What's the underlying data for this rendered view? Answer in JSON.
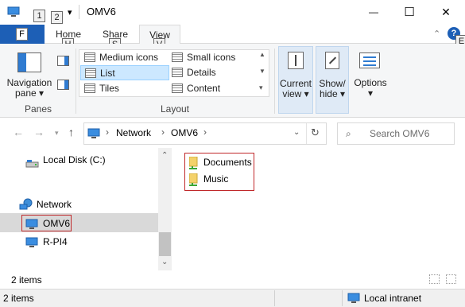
{
  "window": {
    "title": "OMV6",
    "minimize_glyph": "—",
    "maximize_glyph": "☐",
    "close_glyph": "✕"
  },
  "keytips": {
    "qat_1": "1",
    "qat_2": "2",
    "file": "F",
    "home": "H",
    "share": "S",
    "view": "V",
    "help": "E"
  },
  "tabs": {
    "home": "Home",
    "share": "Share",
    "view": "View"
  },
  "ribbon": {
    "panes": {
      "nav_pane_line1": "Navigation",
      "nav_pane_line2": "pane",
      "group_label": "Panes"
    },
    "layout": {
      "medium_icons": "Medium icons",
      "small_icons": "Small icons",
      "list": "List",
      "details": "Details",
      "tiles": "Tiles",
      "content": "Content",
      "group_label": "Layout",
      "selected": "List"
    },
    "current_view": {
      "line1": "Current",
      "line2": "view"
    },
    "show_hide": {
      "line1": "Show/",
      "line2": "hide"
    },
    "options": {
      "label": "Options"
    }
  },
  "address": {
    "segments": [
      "Network",
      "OMV6"
    ],
    "search_placeholder": "Search OMV6"
  },
  "tree": {
    "items": [
      {
        "label": "Local Disk (C:)",
        "icon": "drive-icon",
        "selected": false
      },
      {
        "label": "Network",
        "icon": "network-icon",
        "selected": false
      },
      {
        "label": "OMV6",
        "icon": "computer-icon",
        "selected": true
      },
      {
        "label": "R-PI4",
        "icon": "computer-icon",
        "selected": false
      }
    ]
  },
  "files": {
    "items": [
      {
        "label": "Documents",
        "icon": "shared-folder-icon"
      },
      {
        "label": "Music",
        "icon": "shared-folder-icon"
      }
    ]
  },
  "status": {
    "item_count": "2 items",
    "bottom_count": "2 items",
    "zone": "Local intranet"
  },
  "colors": {
    "file_tab": "#1d5fb6",
    "selection": "#cce8ff",
    "highlight_border": "#c0282a",
    "tree_selected": "#d9d9d9"
  }
}
